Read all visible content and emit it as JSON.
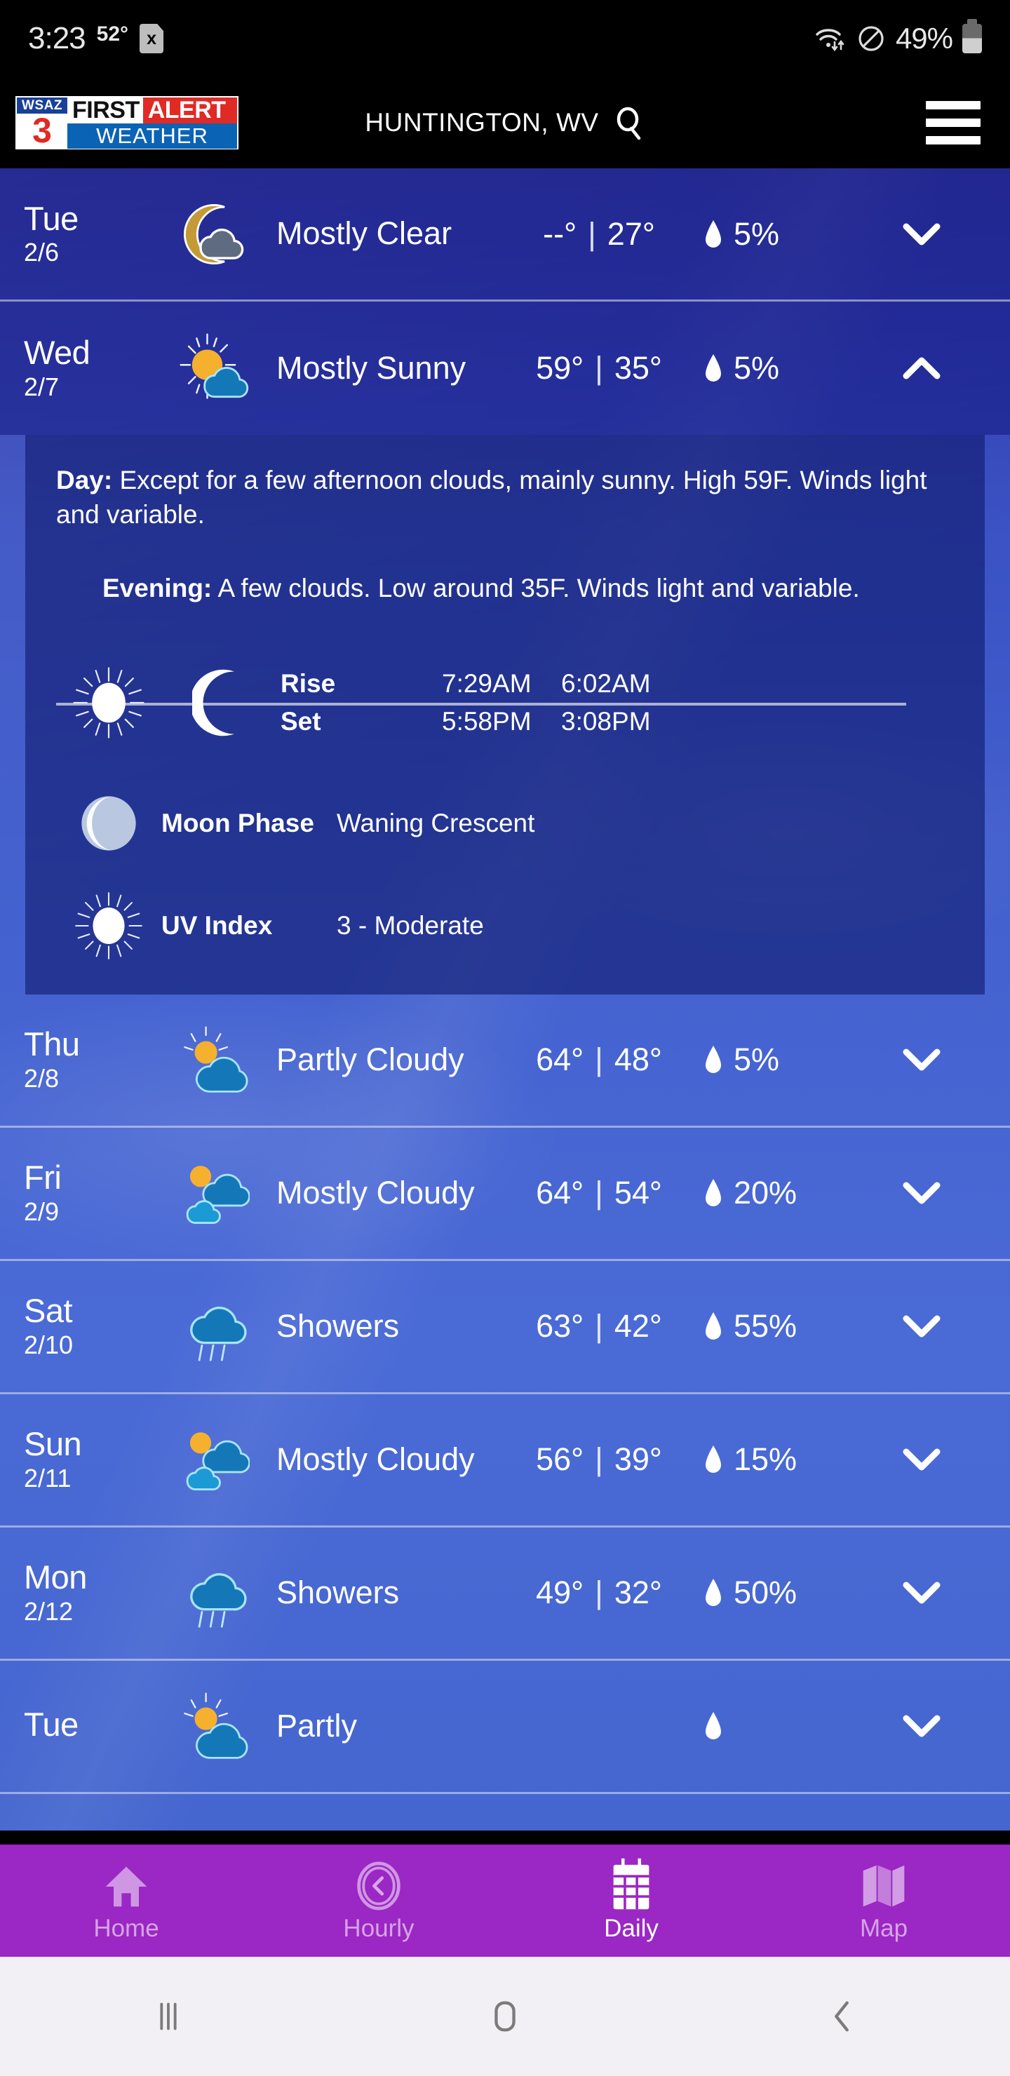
{
  "status_bar": {
    "time": "3:23",
    "temp": "52°",
    "sim_glyph": "x",
    "battery_percent": "49%",
    "icons": [
      "wifi-icon",
      "do-not-disturb-icon",
      "battery-icon"
    ]
  },
  "header": {
    "logo": {
      "station": "WSAZ",
      "channel": "3",
      "first": "FIRST",
      "alert": "ALERT",
      "weather": "WEATHER"
    },
    "city": "HUNTINGTON, WV",
    "search_icon": "search-icon",
    "menu_icon": "hamburger-menu-icon"
  },
  "forecast_rows": [
    {
      "day": "Tue",
      "date": "2/6",
      "icon": "moon-cloud-icon",
      "condition": "Mostly Clear",
      "high": "--°",
      "low": "27°",
      "separator": "|",
      "precip": "5%",
      "chevron": "chevron-down-icon",
      "expanded": false
    },
    {
      "day": "Wed",
      "date": "2/7",
      "icon": "sun-cloud-icon",
      "condition": "Mostly Sunny",
      "high": "59°",
      "low": "35°",
      "separator": "|",
      "precip": "5%",
      "chevron": "chevron-up-icon",
      "expanded": true
    },
    {
      "day": "Thu",
      "date": "2/8",
      "icon": "sun-behind-cloud-icon",
      "condition": "Partly Cloudy",
      "high": "64°",
      "low": "48°",
      "separator": "|",
      "precip": "5%",
      "chevron": "chevron-down-icon",
      "expanded": false
    },
    {
      "day": "Fri",
      "date": "2/9",
      "icon": "sun-two-clouds-icon",
      "condition": "Mostly Cloudy",
      "high": "64°",
      "low": "54°",
      "separator": "|",
      "precip": "20%",
      "chevron": "chevron-down-icon",
      "expanded": false
    },
    {
      "day": "Sat",
      "date": "2/10",
      "icon": "rain-cloud-icon",
      "condition": "Showers",
      "high": "63°",
      "low": "42°",
      "separator": "|",
      "precip": "55%",
      "chevron": "chevron-down-icon",
      "expanded": false
    },
    {
      "day": "Sun",
      "date": "2/11",
      "icon": "sun-two-clouds-icon",
      "condition": "Mostly Cloudy",
      "high": "56°",
      "low": "39°",
      "separator": "|",
      "precip": "15%",
      "chevron": "chevron-down-icon",
      "expanded": false
    },
    {
      "day": "Mon",
      "date": "2/12",
      "icon": "rain-cloud-icon",
      "condition": "Showers",
      "high": "49°",
      "low": "32°",
      "separator": "|",
      "precip": "50%",
      "chevron": "chevron-down-icon",
      "expanded": false
    },
    {
      "day": "Tue",
      "date": "",
      "icon": "sun-behind-cloud-icon",
      "condition": "Partly",
      "high": "",
      "low": "",
      "separator": "",
      "precip": "",
      "chevron": "chevron-down-icon",
      "expanded": false
    }
  ],
  "detail_panel": {
    "day_label": "Day:",
    "day_text": "Except for a few afternoon clouds, mainly sunny. High 59F. Winds light and variable.",
    "evening_label": "Evening:",
    "evening_text": "A few clouds. Low around 35F. Winds light and variable.",
    "rise_label": "Rise",
    "set_label": "Set",
    "sun_rise": "7:29AM",
    "sun_set": "5:58PM",
    "moon_rise": "6:02AM",
    "moon_set": "3:08PM",
    "sun_icon": "sun-icon",
    "moon_icon": "crescent-moon-icon",
    "moon_phase_label": "Moon Phase",
    "moon_phase_value": "Waning Crescent",
    "moon_phase_icon": "moon-phase-icon",
    "uv_label": "UV Index",
    "uv_value": "3 - Moderate",
    "uv_icon": "sun-icon"
  },
  "tabs": [
    {
      "label": "Home",
      "icon": "home-icon",
      "active": false
    },
    {
      "label": "Hourly",
      "icon": "clock-icon",
      "active": false
    },
    {
      "label": "Daily",
      "icon": "calendar-icon",
      "active": true
    },
    {
      "label": "Map",
      "icon": "map-icon",
      "active": false
    }
  ],
  "system_nav": {
    "recents": "recents-icon",
    "home": "home-square-icon",
    "back": "back-chevron-icon"
  },
  "colors": {
    "header_bg": "#000000",
    "tabbar": "#9b27c4",
    "sky_top": "#2a2f9e",
    "sky_bottom": "#4566cf",
    "accent_red": "#e02a26",
    "accent_blue": "#0b63b5"
  }
}
